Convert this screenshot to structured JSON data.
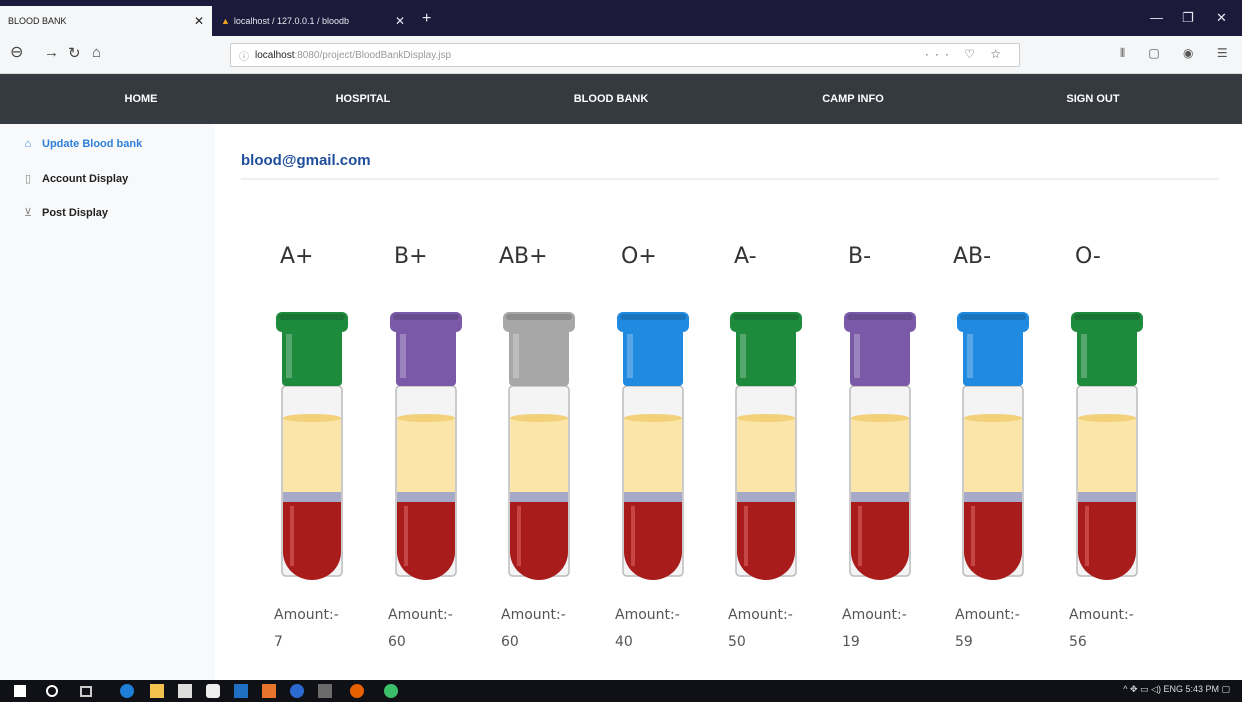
{
  "browser": {
    "tabs": [
      {
        "title": "BLOOD BANK",
        "active": true
      },
      {
        "title": "localhost / 127.0.0.1 / bloodb",
        "active": false
      }
    ],
    "new_tab": "+",
    "url_host": "localhost",
    "url_path": ":8080/project/BloodBankDisplay.jsp",
    "url_icons": "··· ♡ ☆",
    "toolbar_icons": "⫴ ▢ ◉ ☰"
  },
  "topnav": [
    "HOME",
    "HOSPITAL",
    "BLOOD BANK",
    "CAMP INFO",
    "SIGN OUT"
  ],
  "sidebar": [
    {
      "label": "Update Blood bank",
      "icon": "home-icon",
      "color": "#2f7fd8"
    },
    {
      "label": "Account Display",
      "icon": "file-icon",
      "color": "#222222"
    },
    {
      "label": "Post Display",
      "icon": "cart-icon",
      "color": "#222222"
    }
  ],
  "email": "blood@gmail.com",
  "blood_groups": [
    {
      "group": "A+",
      "cap": "#1e8a3c",
      "amount_label": "Amount:-",
      "amount": "7"
    },
    {
      "group": "B+",
      "cap": "#7a5aa8",
      "amount_label": "Amount:-",
      "amount": "60"
    },
    {
      "group": "AB+",
      "cap": "#a7a7a7",
      "amount_label": "Amount:-",
      "amount": "60"
    },
    {
      "group": "O+",
      "cap": "#1f8ae0",
      "amount_label": "Amount:-",
      "amount": "40"
    },
    {
      "group": "A-",
      "cap": "#1e8a3c",
      "amount_label": "Amount:-",
      "amount": "50"
    },
    {
      "group": "B-",
      "cap": "#7a5aa8",
      "amount_label": "Amount:-",
      "amount": "19"
    },
    {
      "group": "AB-",
      "cap": "#1f8ae0",
      "amount_label": "Amount:-",
      "amount": "59"
    },
    {
      "group": "O-",
      "cap": "#1e8a3c",
      "amount_label": "Amount:-",
      "amount": "56"
    }
  ],
  "taskbar": {
    "tray_text": "^ ✥ ▭ ◁) ENG 5:43 PM ▢"
  }
}
